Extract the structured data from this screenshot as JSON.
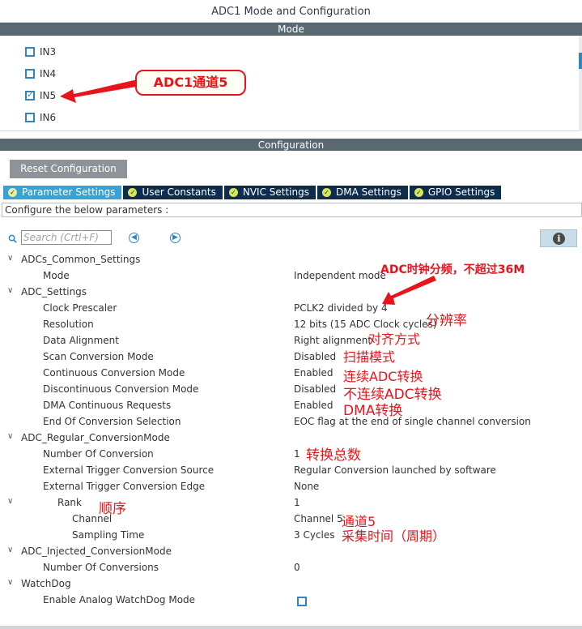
{
  "window": {
    "title": "ADC1 Mode and Configuration"
  },
  "mode_section": {
    "header": "Mode",
    "channels": [
      {
        "label": "IN3",
        "checked": false
      },
      {
        "label": "IN4",
        "checked": false
      },
      {
        "label": "IN5",
        "checked": true
      },
      {
        "label": "IN6",
        "checked": false
      }
    ]
  },
  "callout": {
    "text": "ADC1通道5"
  },
  "config_section": {
    "header": "Configuration",
    "reset_label": "Reset Configuration",
    "tabs": [
      "Parameter Settings",
      "User Constants",
      "NVIC Settings",
      "DMA Settings",
      "GPIO Settings"
    ],
    "active_tab": "Parameter Settings",
    "configure_text": "Configure the below parameters :",
    "search_placeholder": "Search (Crtl+F)"
  },
  "params": [
    {
      "name": "ADCs_Common_Settings",
      "value": "",
      "group": true
    },
    {
      "name": "Mode",
      "value": "Independent mode"
    },
    {
      "name": "ADC_Settings",
      "value": "",
      "group": true
    },
    {
      "name": "Clock Prescaler",
      "value": "PCLK2 divided by 4"
    },
    {
      "name": "Resolution",
      "value": "12 bits (15 ADC Clock cycles)"
    },
    {
      "name": "Data Alignment",
      "value": "Right alignment"
    },
    {
      "name": "Scan Conversion Mode",
      "value": "Disabled"
    },
    {
      "name": "Continuous Conversion Mode",
      "value": "Enabled"
    },
    {
      "name": "Discontinuous Conversion Mode",
      "value": "Disabled"
    },
    {
      "name": "DMA Continuous Requests",
      "value": "Enabled"
    },
    {
      "name": "End Of Conversion Selection",
      "value": "EOC flag at the end of single channel conversion"
    },
    {
      "name": "ADC_Regular_ConversionMode",
      "value": "",
      "group": true
    },
    {
      "name": "Number Of Conversion",
      "value": "1"
    },
    {
      "name": "External Trigger Conversion Source",
      "value": "Regular Conversion launched by software"
    },
    {
      "name": "External Trigger Conversion Edge",
      "value": "None"
    },
    {
      "name": "Rank",
      "value": "1",
      "group": true
    },
    {
      "name": "Channel",
      "value": "Channel 5"
    },
    {
      "name": "Sampling Time",
      "value": "3 Cycles"
    },
    {
      "name": "ADC_Injected_ConversionMode",
      "value": "",
      "group": true
    },
    {
      "name": "Number Of Conversions",
      "value": "0"
    },
    {
      "name": "WatchDog",
      "value": "",
      "group": true
    },
    {
      "name": "Enable Analog WatchDog Mode",
      "value": "",
      "checkbox": true,
      "checked": false
    }
  ],
  "annotations": {
    "clock": "ADC时钟分频，不超过36M",
    "resolution": "分辨率",
    "alignment": "对齐方式",
    "scan": "扫描模式",
    "continuous": "连续ADC转换",
    "discontinuous": "不连续ADC转换",
    "dma": "DMA转换",
    "total": "转换总数",
    "rank": "顺序",
    "channel": "通道5",
    "sampling": "采集时间（周期）"
  },
  "colors": {
    "accent": "#2f86c2",
    "header": "#5a6872",
    "tab_dark": "#0d2d4e",
    "tab_active": "#35a3d6",
    "annotation_red": "#e8141c"
  }
}
